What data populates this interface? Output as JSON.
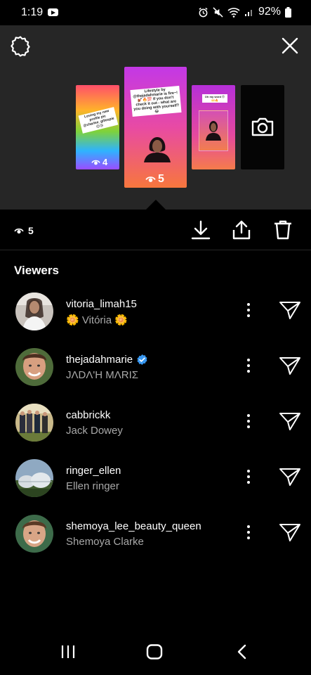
{
  "status_bar": {
    "time": "1:19",
    "battery": "92%"
  },
  "stories": [
    {
      "sticker": "Loving my new profile pic @charlee_gillespie 😍😘",
      "views": "4"
    },
    {
      "sticker": "Lifestyle by @thejadahmarie is fire~! 💅🏾🔥💯 If you don't check it out - what are you doing with yourself?😂",
      "views": "5"
    },
    {
      "sticker": "Oh my word 😍🙌🔥"
    }
  ],
  "actions": {
    "views_count": "5"
  },
  "viewers_title": "Viewers",
  "viewers": [
    {
      "username": "vitoria_limah15",
      "name": "🌼 Vitória 🌼",
      "verified": false
    },
    {
      "username": "thejadahmarie",
      "name": "JΛDΛ'H MΛRIΣ",
      "verified": true
    },
    {
      "username": "cabbrickk",
      "name": "Jack Dowey",
      "verified": false
    },
    {
      "username": "ringer_ellen",
      "name": "Ellen ringer",
      "verified": false
    },
    {
      "username": "shemoya_lee_beauty_queen",
      "name": "Shemoya Clarke",
      "verified": false
    }
  ],
  "colors": {
    "background": "#000000",
    "panel": "#262626",
    "secondary_text": "#a8a8a8",
    "verified": "#3897f0"
  }
}
